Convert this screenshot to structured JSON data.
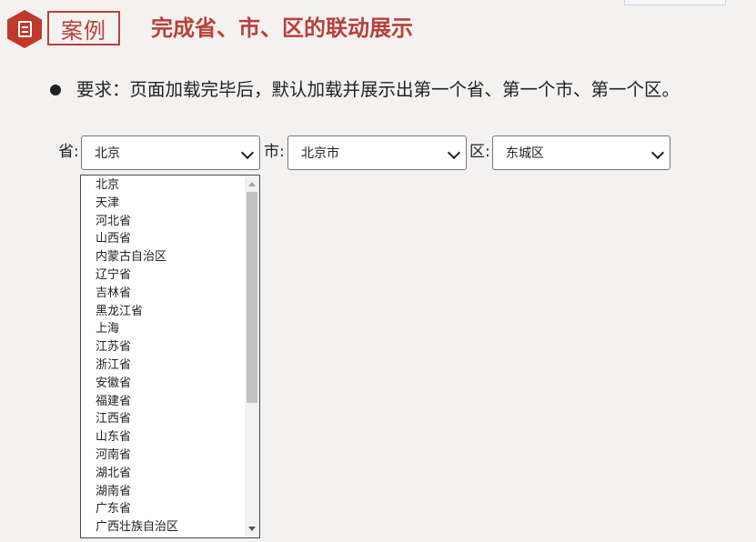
{
  "header": {
    "case_label": "案例",
    "title": "完成省、市、区的联动展示"
  },
  "requirement": {
    "text": "要求：页面加载完毕后，默认加载并展示出第一个省、第一个市、第一个区。"
  },
  "form": {
    "province_label": "省:",
    "province_selected": "北京",
    "city_label": "市:",
    "city_selected": "北京市",
    "district_label": "区:",
    "district_selected": "东城区"
  },
  "province_options": [
    "北京",
    "天津",
    "河北省",
    "山西省",
    "内蒙古自治区",
    "辽宁省",
    "吉林省",
    "黑龙江省",
    "上海",
    "江苏省",
    "浙江省",
    "安徽省",
    "福建省",
    "江西省",
    "山东省",
    "河南省",
    "湖北省",
    "湖南省",
    "广东省",
    "广西壮族自治区"
  ],
  "colors": {
    "accent": "#b8413a",
    "background": "#f3f2f1"
  }
}
